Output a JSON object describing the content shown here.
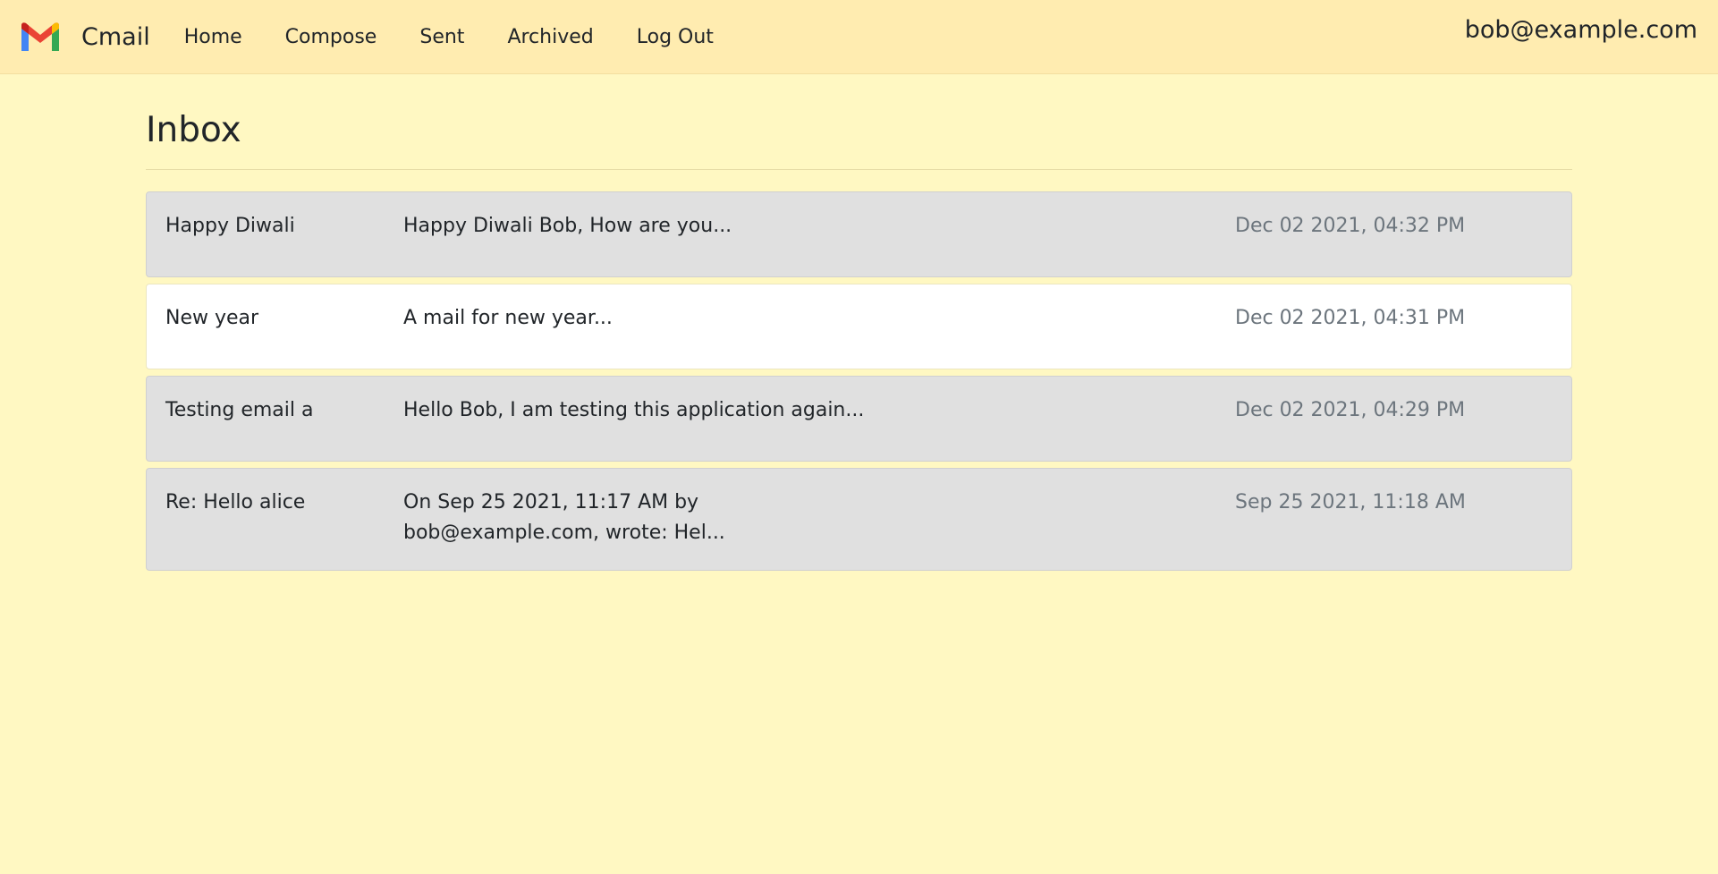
{
  "navbar": {
    "brand": "Cmail",
    "links": [
      "Home",
      "Compose",
      "Sent",
      "Archived",
      "Log Out"
    ],
    "user_email": "bob@example.com"
  },
  "main": {
    "title": "Inbox",
    "emails": [
      {
        "subject": "Happy Diwali",
        "preview": "Happy Diwali Bob, How are you...",
        "timestamp": "Dec 02 2021, 04:32 PM",
        "read": false
      },
      {
        "subject": "New year",
        "preview": "A mail for new year...",
        "timestamp": "Dec 02 2021, 04:31 PM",
        "read": true
      },
      {
        "subject": "Testing email a",
        "preview": "Hello Bob, I am testing this application again...",
        "timestamp": "Dec 02 2021, 04:29 PM",
        "read": false
      },
      {
        "subject": "Re: Hello alice",
        "preview": "On Sep 25 2021, 11:17 AM by bob@example.com, wrote: Hel...",
        "timestamp": "Sep 25 2021, 11:18 AM",
        "read": false
      }
    ]
  },
  "colors": {
    "page_background": "#fff8c2",
    "navbar_background": "#ffecb0",
    "unread_row": "#e0e0e0",
    "read_row": "#ffffff",
    "timestamp_text": "#6c757d"
  },
  "icons": {
    "logo": "gmail-m-icon"
  }
}
